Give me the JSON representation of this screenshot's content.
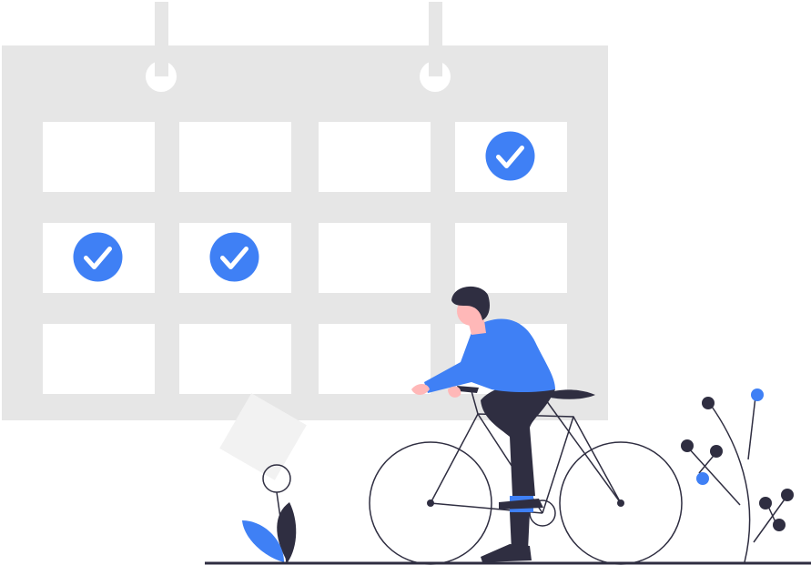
{
  "illustration": {
    "subject": "calendar-with-checked-days-and-cyclist",
    "checked_cells": [
      {
        "row": 0,
        "col": 3
      },
      {
        "row": 1,
        "col": 0
      },
      {
        "row": 1,
        "col": 1
      }
    ],
    "calendar_grid": {
      "rows": 3,
      "cols": 4
    },
    "colors": {
      "calendar": "#e6e6e6",
      "cell": "#ffffff",
      "accent": "#3f80f5",
      "dark": "#2f2e41",
      "skin": "#ffb8b8",
      "paper": "#f2f2f2"
    }
  }
}
